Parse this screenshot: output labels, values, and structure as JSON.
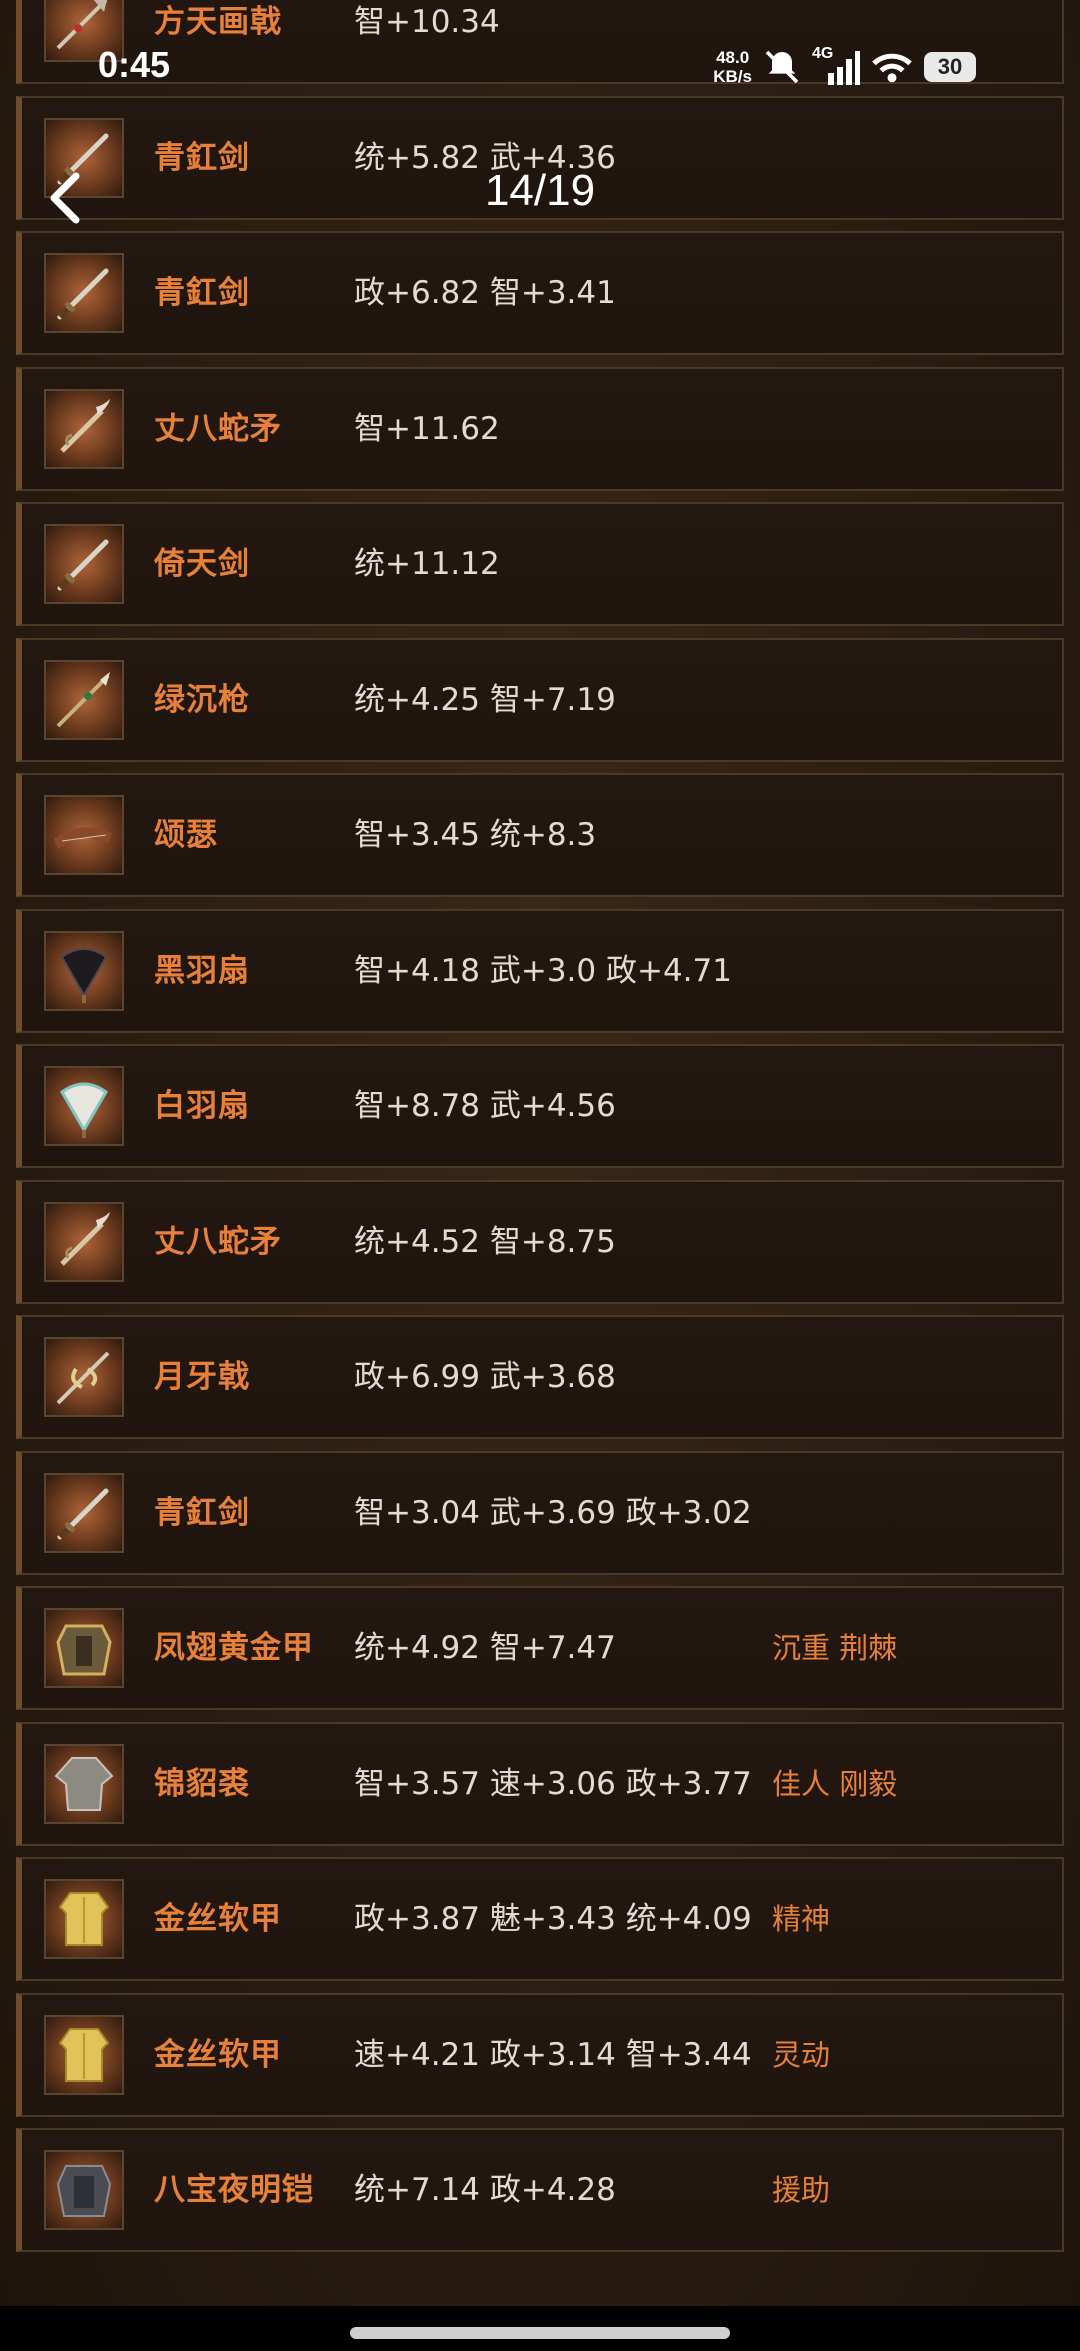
{
  "status_bar": {
    "time": "0:45",
    "net_speed_value": "48.0",
    "net_speed_unit": "KB/s",
    "network": "4G",
    "battery": "30"
  },
  "header": {
    "page_counter": "14/19"
  },
  "items": [
    {
      "name": "方天画戟",
      "stats": "智+10.34",
      "trait": "",
      "icon": "halberd-icon"
    },
    {
      "name": "青釭剑",
      "stats": "统+5.82 武+4.36",
      "trait": "",
      "icon": "sword-icon"
    },
    {
      "name": "青釭剑",
      "stats": "政+6.82 智+3.41",
      "trait": "",
      "icon": "sword-icon"
    },
    {
      "name": "丈八蛇矛",
      "stats": "智+11.62",
      "trait": "",
      "icon": "snake-spear-icon"
    },
    {
      "name": "倚天剑",
      "stats": "统+11.12",
      "trait": "",
      "icon": "sword-icon"
    },
    {
      "name": "绿沉枪",
      "stats": "统+4.25 智+7.19",
      "trait": "",
      "icon": "spear-icon"
    },
    {
      "name": "颂瑟",
      "stats": "智+3.45 统+8.3",
      "trait": "",
      "icon": "zither-icon"
    },
    {
      "name": "黑羽扇",
      "stats": "智+4.18 武+3.0 政+4.71",
      "trait": "",
      "icon": "black-fan-icon"
    },
    {
      "name": "白羽扇",
      "stats": "智+8.78 武+4.56",
      "trait": "",
      "icon": "white-fan-icon"
    },
    {
      "name": "丈八蛇矛",
      "stats": "统+4.52 智+8.75",
      "trait": "",
      "icon": "snake-spear-icon"
    },
    {
      "name": "月牙戟",
      "stats": "政+6.99 武+3.68",
      "trait": "",
      "icon": "crescent-halberd-icon"
    },
    {
      "name": "青釭剑",
      "stats": "智+3.04 武+3.69 政+3.02",
      "trait": "",
      "icon": "sword-icon"
    },
    {
      "name": "凤翅黄金甲",
      "stats": "统+4.92 智+7.47",
      "trait": "沉重 荆棘",
      "icon": "armor-icon"
    },
    {
      "name": "锦貂裘",
      "stats": "智+3.57 速+3.06 政+3.77",
      "trait": "佳人 刚毅",
      "icon": "robe-icon"
    },
    {
      "name": "金丝软甲",
      "stats": "政+3.87 魅+3.43 统+4.09",
      "trait": "精神",
      "icon": "gold-vest-icon"
    },
    {
      "name": "金丝软甲",
      "stats": "速+4.21 政+3.14 智+3.44",
      "trait": "灵动",
      "icon": "gold-vest-icon"
    },
    {
      "name": "八宝夜明铠",
      "stats": "统+7.14 政+4.28",
      "trait": "援助",
      "icon": "dark-armor-icon"
    }
  ]
}
